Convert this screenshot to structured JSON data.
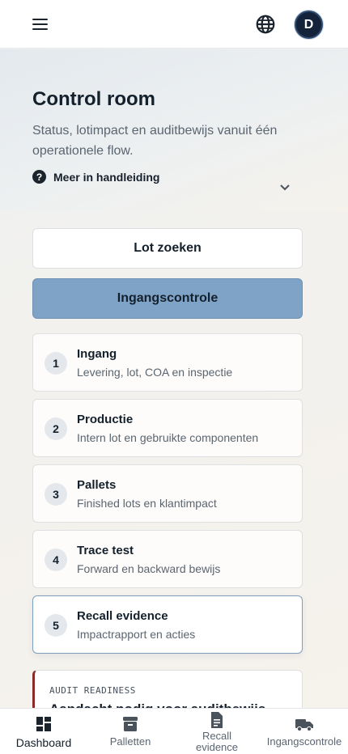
{
  "header": {
    "menu_icon": "hamburger-menu-icon",
    "language_icon": "globe-icon",
    "avatar_initial": "D"
  },
  "hero": {
    "title": "Control room",
    "subtitle": "Status, lotimpact en auditbewijs vanuit één operationele flow.",
    "help_label": "Meer in handleiding",
    "help_icon_glyph": "?"
  },
  "actions": {
    "lot_search_label": "Lot zoeken",
    "inbound_label": "Ingangscontrole"
  },
  "steps": [
    {
      "number": "1",
      "title": "Ingang",
      "description": "Levering, lot, COA en inspectie"
    },
    {
      "number": "2",
      "title": "Productie",
      "description": "Intern lot en gebruikte componenten"
    },
    {
      "number": "3",
      "title": "Pallets",
      "description": "Finished lots en klantimpact"
    },
    {
      "number": "4",
      "title": "Trace test",
      "description": "Forward en backward bewijs"
    },
    {
      "number": "5",
      "title": "Recall evidence",
      "description": "Impactrapport en acties"
    }
  ],
  "audit": {
    "label": "AUDIT READINESS",
    "title": "Aandacht nodig voor auditbewijs",
    "accent_color": "#8b2a2a"
  },
  "bottom_nav": [
    {
      "label": "Dashboard",
      "icon": "dashboard-icon"
    },
    {
      "label": "Palletten",
      "icon": "archive-box-icon"
    },
    {
      "label": "Recall",
      "label2": "evidence",
      "icon": "document-icon"
    },
    {
      "label": "Ingangscontrole",
      "icon": "truck-icon"
    }
  ],
  "colors": {
    "primary_button": "#7fa3c6",
    "avatar_bg": "#14233a",
    "active_step_border": "#7f9fbf"
  }
}
